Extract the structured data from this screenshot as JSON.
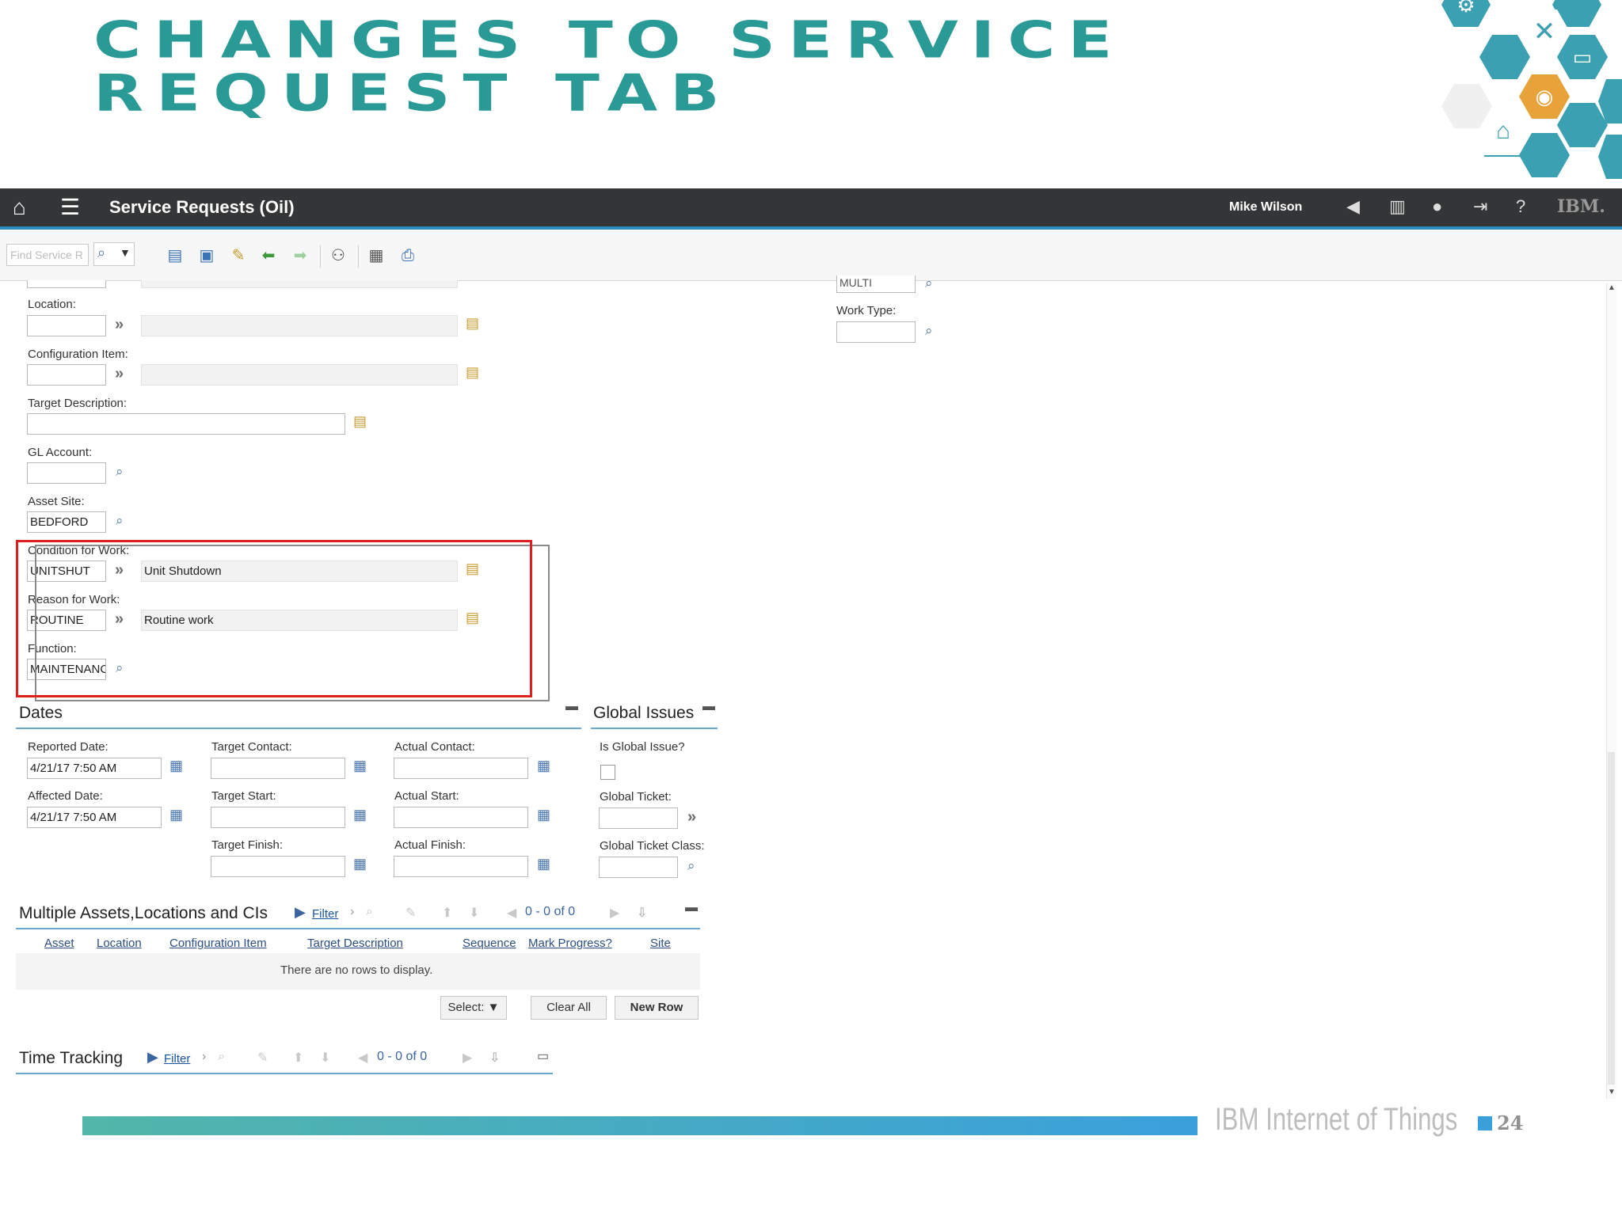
{
  "slide": {
    "title_line1": "Changes to Service",
    "title_line2": "Request tab",
    "footer_text": "IBM Internet of Things",
    "page_number": "24"
  },
  "app": {
    "title": "Service Requests (Oil)",
    "user": "Mike Wilson",
    "logo": "IBM.",
    "find_placeholder": "Find Service R"
  },
  "form": {
    "multi_value": "MULTI",
    "location_label": "Location:",
    "config_item_label": "Configuration Item:",
    "target_desc_label": "Target Description:",
    "gl_account_label": "GL Account:",
    "asset_site_label": "Asset Site:",
    "asset_site_value": "BEDFORD",
    "condition_label": "Condition for Work:",
    "condition_value": "UNITSHUT",
    "condition_desc": "Unit Shutdown",
    "reason_label": "Reason for Work:",
    "reason_value": "ROUTINE",
    "reason_desc": "Routine work",
    "function_label": "Function:",
    "function_value": "MAINTENANCI",
    "work_type_label": "Work Type:"
  },
  "dates": {
    "heading": "Dates",
    "reported_label": "Reported Date:",
    "reported_value": "4/21/17 7:50 AM",
    "affected_label": "Affected Date:",
    "affected_value": "4/21/17 7:50 AM",
    "target_contact_label": "Target Contact:",
    "target_start_label": "Target Start:",
    "target_finish_label": "Target Finish:",
    "actual_contact_label": "Actual Contact:",
    "actual_start_label": "Actual Start:",
    "actual_finish_label": "Actual Finish:"
  },
  "global": {
    "heading": "Global Issues",
    "is_global_label": "Is Global Issue?",
    "ticket_label": "Global Ticket:",
    "ticket_class_label": "Global Ticket Class:"
  },
  "multi_assets": {
    "heading": "Multiple Assets,Locations and CIs",
    "filter": "Filter",
    "pagination": "0 - 0 of 0",
    "columns": [
      "Asset",
      "Location",
      "Configuration Item",
      "Target Description",
      "Sequence",
      "Mark Progress?",
      "Site"
    ],
    "empty": "There are no rows to display.",
    "select_btn": "Select:",
    "clear_btn": "Clear All",
    "new_row_btn": "New Row"
  },
  "time_tracking": {
    "heading": "Time Tracking",
    "filter": "Filter",
    "pagination": "0 - 0 of 0"
  },
  "colors": {
    "title_teal": "#2a9a96",
    "accent_blue": "#2a8bc0",
    "highlight_red": "#e01e1e",
    "hex_orange": "#e8a23a"
  }
}
